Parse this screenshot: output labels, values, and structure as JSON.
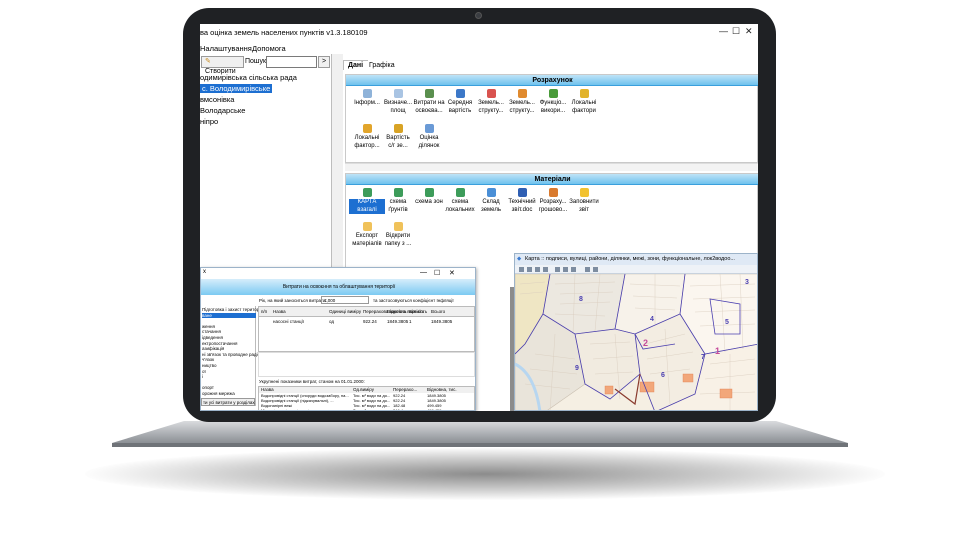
{
  "window": {
    "title": "ва оцінка земель населених пунктів v1.3.180109",
    "minimize": "—",
    "maximize": "☐",
    "close": "✕"
  },
  "menubar": [
    "Налаштування",
    "Допомога"
  ],
  "toolbar": {
    "create_label": "Створити",
    "search_label": "Пошук:",
    "search_value": "",
    "go_label": ">"
  },
  "tree": [
    {
      "label": "одимирівська сільська рада",
      "selected": false
    },
    {
      "label": "с. Володимирівське",
      "selected": true
    },
    {
      "label": "вмсонівка",
      "selected": false
    },
    {
      "label": "Володарське",
      "selected": false
    },
    {
      "label": "ніпро",
      "selected": false
    }
  ],
  "tabs": [
    "Дані",
    "Графіка"
  ],
  "section_calc": {
    "title": "Розрахунок",
    "items": [
      {
        "l1": "Інформ...",
        "l2": "",
        "icon": "info-doc-icon",
        "color": "#8fb3d9"
      },
      {
        "l1": "Визначе...",
        "l2": "площ",
        "icon": "area-doc-icon",
        "color": "#a9c4e3"
      },
      {
        "l1": "Витрати на",
        "l2": "освоєва...",
        "icon": "dollar-icon",
        "color": "#5a8f4e"
      },
      {
        "l1": "Середня",
        "l2": "вартість",
        "icon": "chart-icon",
        "color": "#3c78c8"
      },
      {
        "l1": "Земель...",
        "l2": "структу...",
        "icon": "pie-icon",
        "color": "#d9534f"
      },
      {
        "l1": "Земель...",
        "l2": "структу...",
        "icon": "pie-icon",
        "color": "#e08a2e"
      },
      {
        "l1": "Функціо...",
        "l2": "викори...",
        "icon": "function-icon",
        "color": "#4a9b3a"
      },
      {
        "l1": "Локальні",
        "l2": "фактори",
        "icon": "pencil-icon",
        "color": "#e2b32b"
      },
      {
        "l1": "Локальні",
        "l2": "фактор...",
        "icon": "pencil-icon",
        "color": "#e2a52b"
      },
      {
        "l1": "Вартість",
        "l2": "с/г зе...",
        "icon": "wheat-icon",
        "color": "#d8a325"
      },
      {
        "l1": "Оцінка",
        "l2": "ділянок",
        "icon": "house-icon",
        "color": "#6a9ad6"
      }
    ]
  },
  "section_materials": {
    "title": "Матеріали",
    "items": [
      {
        "l1": "КАРТА",
        "l2": "взагалі",
        "icon": "globe-icon",
        "color": "#3d9c5a",
        "selected": true
      },
      {
        "l1": "схема",
        "l2": "ґрунтів",
        "icon": "globe-icon",
        "color": "#3d9c5a",
        "selected": false
      },
      {
        "l1": "схема зон",
        "l2": "",
        "icon": "globe-icon",
        "color": "#3d9c5a",
        "selected": false
      },
      {
        "l1": "схема",
        "l2": "локальних",
        "icon": "globe-icon",
        "color": "#3d9c5a",
        "selected": false
      },
      {
        "l1": "Склад",
        "l2": "земель",
        "icon": "table-doc-icon",
        "color": "#4a8fd6",
        "selected": false
      },
      {
        "l1": "Технічний",
        "l2": "звіт.doc",
        "icon": "word-doc-icon",
        "color": "#2f5fb3",
        "selected": false
      },
      {
        "l1": "Розраху...",
        "l2": "грошово...",
        "icon": "calc-doc-icon",
        "color": "#d97a2e",
        "selected": false
      },
      {
        "l1": "Заповнити",
        "l2": "звіт",
        "icon": "bulb-icon",
        "color": "#f2c230",
        "selected": false
      },
      {
        "l1": "Експорт",
        "l2": "матеріалів",
        "icon": "folder-icon",
        "color": "#f0c25a",
        "selected": false
      },
      {
        "l1": "Відкрити",
        "l2": "папку з ...",
        "icon": "folder-icon",
        "color": "#f0c25a",
        "selected": false
      }
    ]
  },
  "cost_window": {
    "title": "Витрати на освоєння та облаштування території",
    "row_label": "Рік, на який заноситься витрати:",
    "row_value": "1,000",
    "row_note": "та застосовуються коефіцієнт Інфляції",
    "left_list": [
      "Підготовка і захист території",
      "ване",
      "",
      "ження",
      "стачання",
      "ідведення",
      "ектропостачання",
      "азифікація",
      "ні зв'язок та проводне радіо",
      "ч'язок",
      "ництво",
      "ої",
      "і",
      "",
      "опорт",
      "орожня мережа"
    ],
    "left_footer": "ти усі витрати у розділах",
    "table_headers": [
      "п/п",
      "Назва",
      "Одиниці виміру",
      "Перерахова вартість",
      "Відновна вартість",
      "Кількість",
      "Всього"
    ],
    "table_rows": [
      [
        "",
        "насосні станції",
        "од",
        "922.24",
        "1849.3805",
        "1",
        "1849.3805"
      ]
    ],
    "bottom_caption": "Укрупнені показники витрат, станом на 01.01.2000:",
    "bottom_headers": [
      "Назва",
      "Од.виміру",
      "Перерахо...",
      "Відновна, тис."
    ],
    "bottom_rows": [
      [
        "Водопровідні станції (споруди водозабору, на...",
        "Тис. м³ води на до...",
        "922.24",
        "1849.3805"
      ],
      [
        "Водопровідні станції (підкачувальні), ...",
        "Тис. м³ води на до...",
        "922.24",
        "1849.3805"
      ],
      [
        "Водонапірні вежі",
        "Тис. м³ води на до...",
        "182.48",
        "499.459"
      ],
      [
        "Місцеві артезіанські водні",
        "Тис. м³ води на до...",
        "246.4",
        "499.459"
      ]
    ]
  },
  "map_window": {
    "title": "Карта :: подписи, вулиці, райони, ділянки, межі, зони, функціональне, лок2водоо...",
    "zone_numbers": [
      "1",
      "2",
      "3",
      "4",
      "5",
      "6",
      "7",
      "8",
      "9"
    ]
  },
  "colors": {
    "section_header_top": "#bfe3f7",
    "section_header_bottom": "#6fc2ee",
    "selection": "#1d6fd1",
    "device_bezel": "#1f2124",
    "map_zone_border": "#4a3fb0",
    "map_label": "#c44a9a"
  }
}
